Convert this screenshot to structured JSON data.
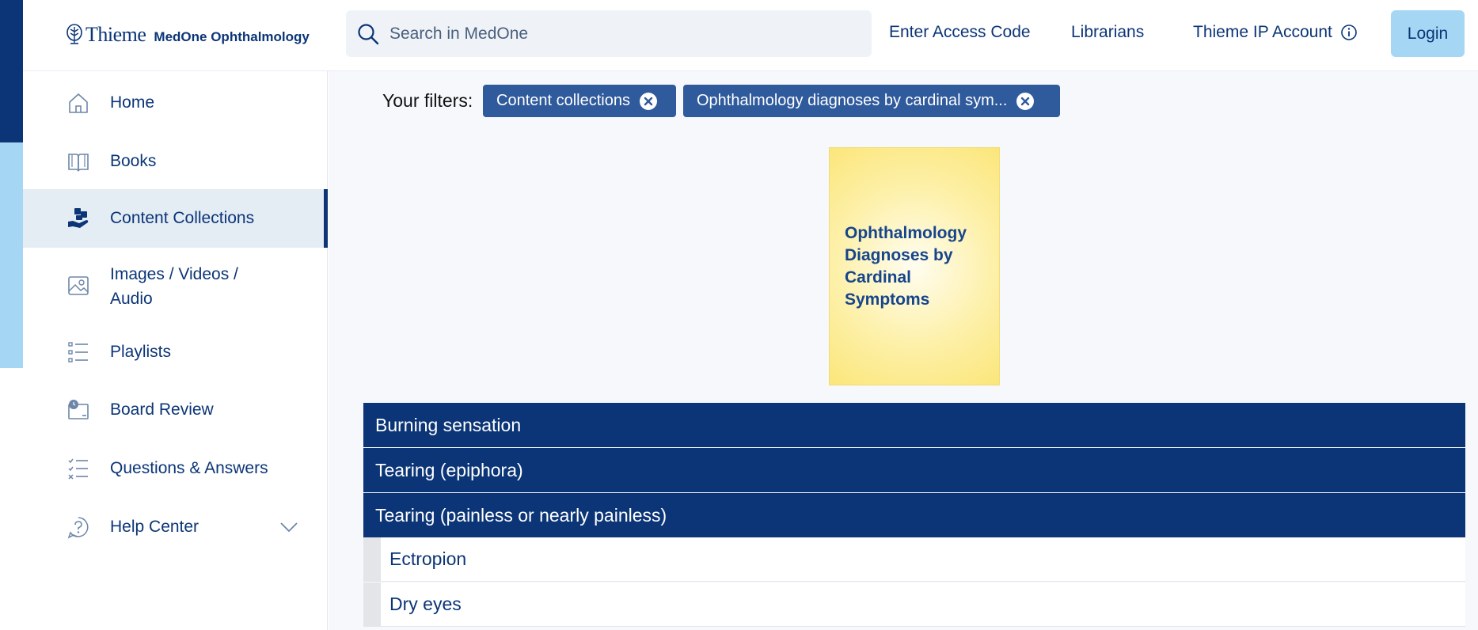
{
  "header": {
    "brand": "Thieme",
    "product": "MedOne Ophthalmology",
    "search_placeholder": "Search in MedOne",
    "links": [
      "Enter Access Code",
      "Librarians",
      "Thieme IP Account"
    ],
    "login_label": "Login"
  },
  "sidebar": {
    "items": [
      {
        "label": "Home",
        "icon": "home-icon"
      },
      {
        "label": "Books",
        "icon": "book-icon"
      },
      {
        "label": "Content Collections",
        "icon": "collections-icon",
        "active": true
      },
      {
        "label": "Images / Videos / Audio",
        "icon": "image-icon"
      },
      {
        "label": "Playlists",
        "icon": "playlist-icon"
      },
      {
        "label": "Board Review",
        "icon": "board-review-icon"
      },
      {
        "label": "Questions & Answers",
        "icon": "checklist-icon"
      },
      {
        "label": "Help Center",
        "icon": "help-icon"
      }
    ]
  },
  "filters": {
    "label": "Your filters:",
    "chips": [
      "Content collections",
      "Ophthalmology diagnoses by cardinal sym..."
    ]
  },
  "cover": {
    "title": "Ophthalmology Diagnoses by Cardinal Symptoms"
  },
  "accordion": {
    "sections": [
      "Burning sensation",
      "Tearing (epiphora)",
      "Tearing (painless or nearly painless)"
    ],
    "subitems": [
      "Ectropion",
      "Dry eyes"
    ]
  },
  "colors": {
    "navy": "#0b3577",
    "light_blue": "#a5d7f5",
    "chip_blue": "#2f5a9c"
  }
}
